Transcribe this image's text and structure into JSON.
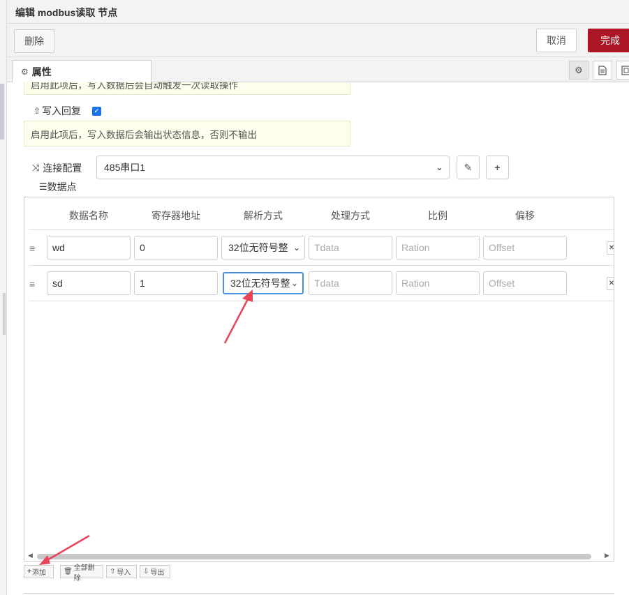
{
  "header": {
    "title": "编辑 modbus读取 节点"
  },
  "toolbar": {
    "delete_label": "删除",
    "cancel_label": "取消",
    "done_label": "完成"
  },
  "tabs": {
    "properties_label": "属性"
  },
  "form": {
    "tip_top": "启用此项后，写入数据后会自动触发一次读取操作",
    "write_reply_label": "写入回复",
    "write_reply_checked": true,
    "tip_mid": "启用此项后，写入数据后会输出状态信息，否则不输出",
    "connection_label": "连接配置",
    "connection_value": "485串口1",
    "datapoints_label": "数据点"
  },
  "table": {
    "headers": [
      "数据名称",
      "寄存器地址",
      "解析方式",
      "处理方式",
      "比例",
      "偏移"
    ],
    "rows": [
      {
        "name": "wd",
        "address": "0",
        "parse": "32位无符号整",
        "process_placeholder": "Tdata",
        "ratio_placeholder": "Ration",
        "offset_placeholder": "Offset"
      },
      {
        "name": "sd",
        "address": "1",
        "parse": "32位无符号整",
        "process_placeholder": "Tdata",
        "ratio_placeholder": "Ration",
        "offset_placeholder": "Offset"
      }
    ]
  },
  "footer_buttons": {
    "add": "添加",
    "delete_all": "全部删除",
    "import": "导入",
    "export": "导出"
  },
  "colors": {
    "done_button": "#ad1625",
    "annotation_arrow": "#e8445a",
    "tip_background": "#ffffed",
    "checkbox": "#1a73e8"
  }
}
